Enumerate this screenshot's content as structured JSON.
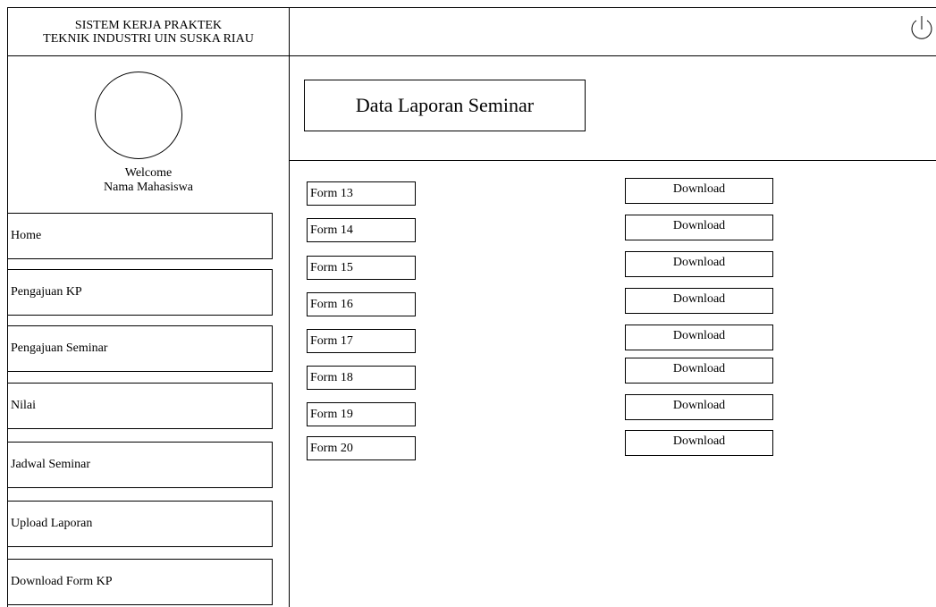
{
  "app": {
    "title_line1": "SISTEM KERJA PRAKTEK",
    "title_line2": "TEKNIK INDUSTRI UIN SUSKA RIAU"
  },
  "header": {
    "power_icon": "power-icon"
  },
  "sidebar": {
    "welcome": "Welcome",
    "user_name": "Nama Mahasiswa",
    "items": [
      {
        "label": "Home"
      },
      {
        "label": "Pengajuan KP"
      },
      {
        "label": "Pengajuan Seminar"
      },
      {
        "label": "Nilai"
      },
      {
        "label": "Jadwal Seminar"
      },
      {
        "label": "Upload Laporan"
      },
      {
        "label": "Download Form KP"
      }
    ]
  },
  "main": {
    "page_title": "Data Laporan Seminar",
    "forms": [
      {
        "label": "Form 13",
        "action": "Download"
      },
      {
        "label": "Form 14",
        "action": "Download"
      },
      {
        "label": "Form 15",
        "action": "Download"
      },
      {
        "label": "Form 16",
        "action": "Download"
      },
      {
        "label": "Form 17",
        "action": "Download"
      },
      {
        "label": "Form 18",
        "action": "Download"
      },
      {
        "label": "Form 19",
        "action": "Download"
      },
      {
        "label": "Form 20",
        "action": "Download"
      }
    ]
  }
}
